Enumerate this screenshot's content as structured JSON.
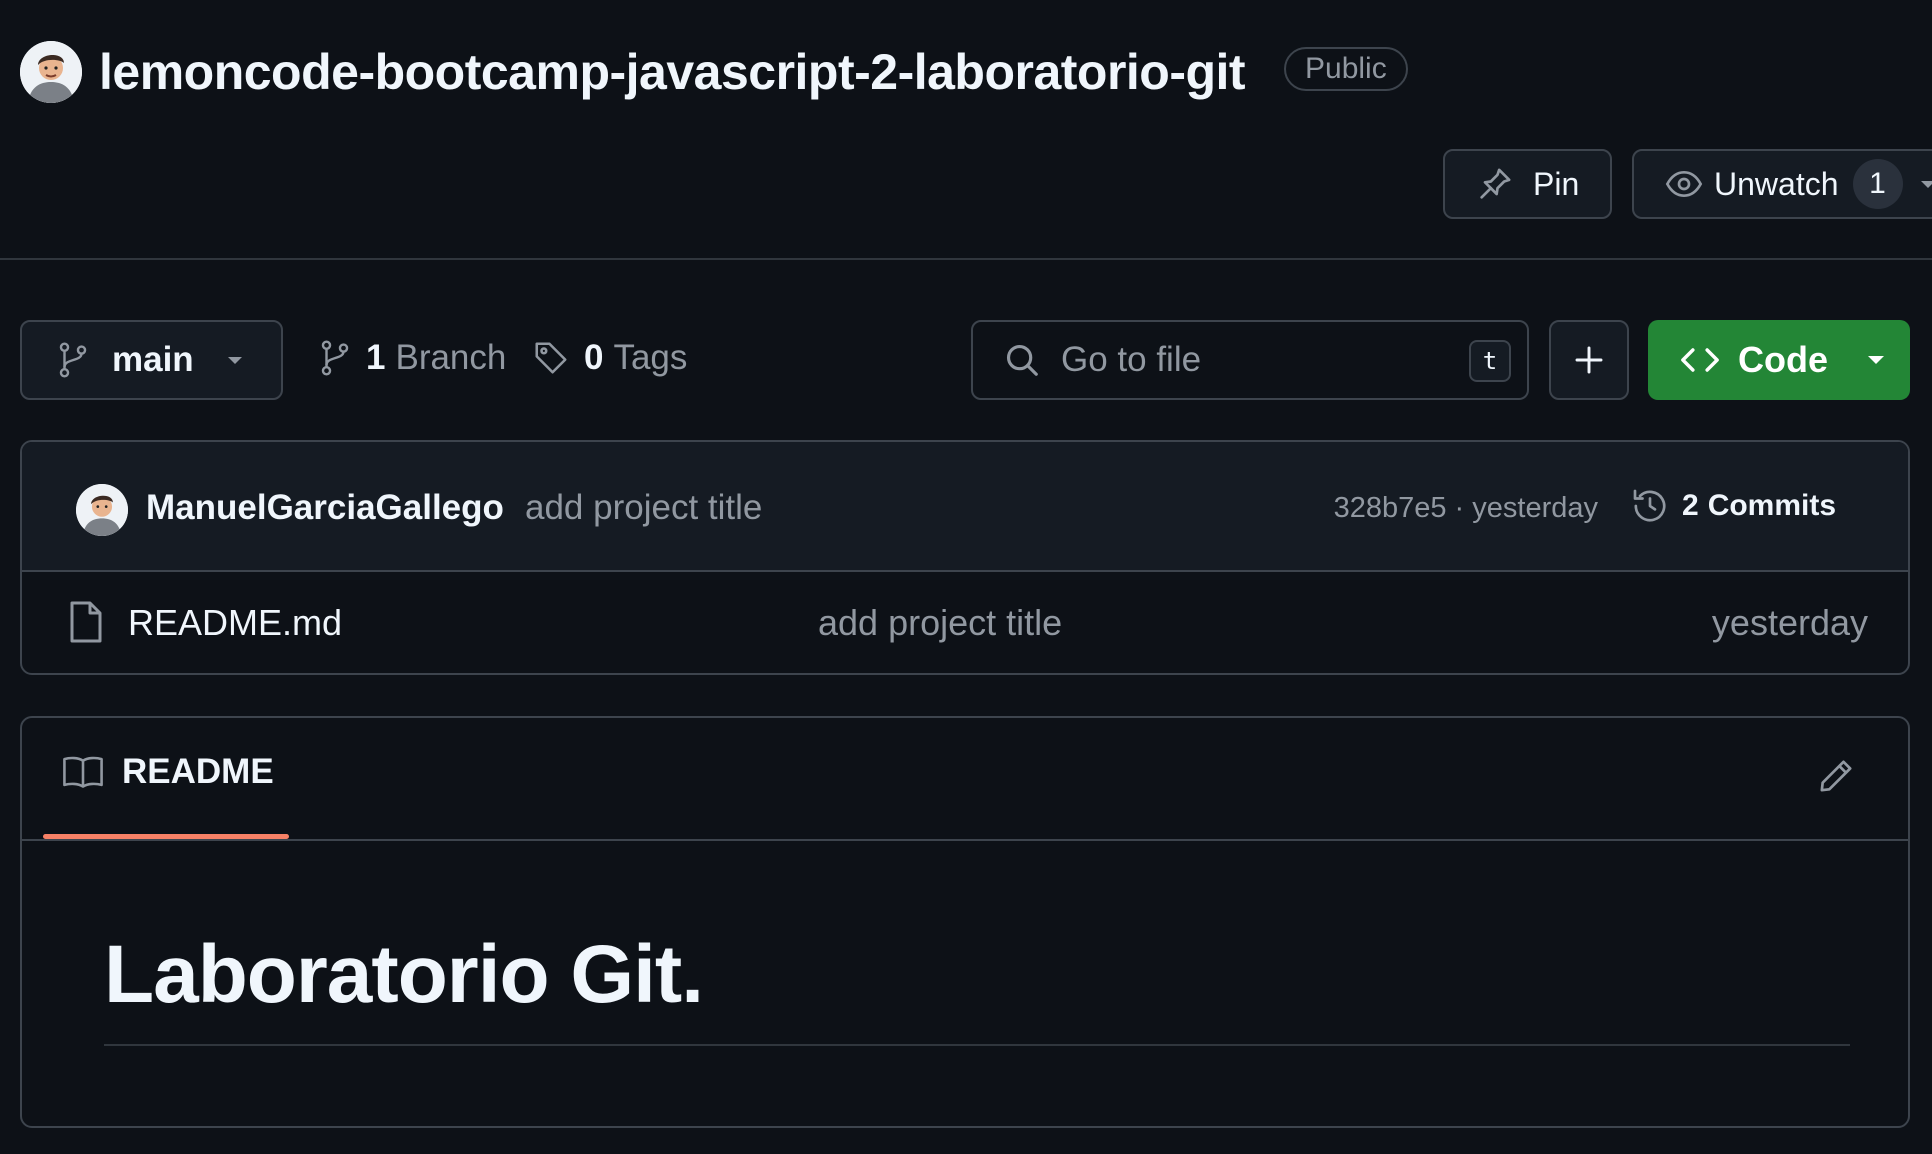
{
  "repo": {
    "name": "lemoncode-bootcamp-javascript-2-laboratorio-git",
    "visibility": "Public",
    "pin_label": "Pin",
    "unwatch_label": "Unwatch",
    "watch_count": "1"
  },
  "toolbar": {
    "branch": "main",
    "branch_count": "1",
    "branch_label": "Branch",
    "tag_count": "0",
    "tag_label": "Tags",
    "search_placeholder": "Go to file",
    "search_shortcut": "t",
    "code_label": "Code"
  },
  "latest_commit": {
    "author": "ManuelGarciaGallego",
    "message": "add project title",
    "hash": "328b7e5",
    "separator": "·",
    "time": "yesterday",
    "commits_count": "2",
    "commits_label": "Commits"
  },
  "files": [
    {
      "name": "README.md",
      "message": "add project title",
      "date": "yesterday"
    }
  ],
  "readme": {
    "tab_label": "README",
    "heading": "Laboratorio Git."
  },
  "colors": {
    "background": "#0d1117",
    "border": "#3d444d",
    "accent_green": "#238636",
    "tab_underline": "#f78166"
  }
}
